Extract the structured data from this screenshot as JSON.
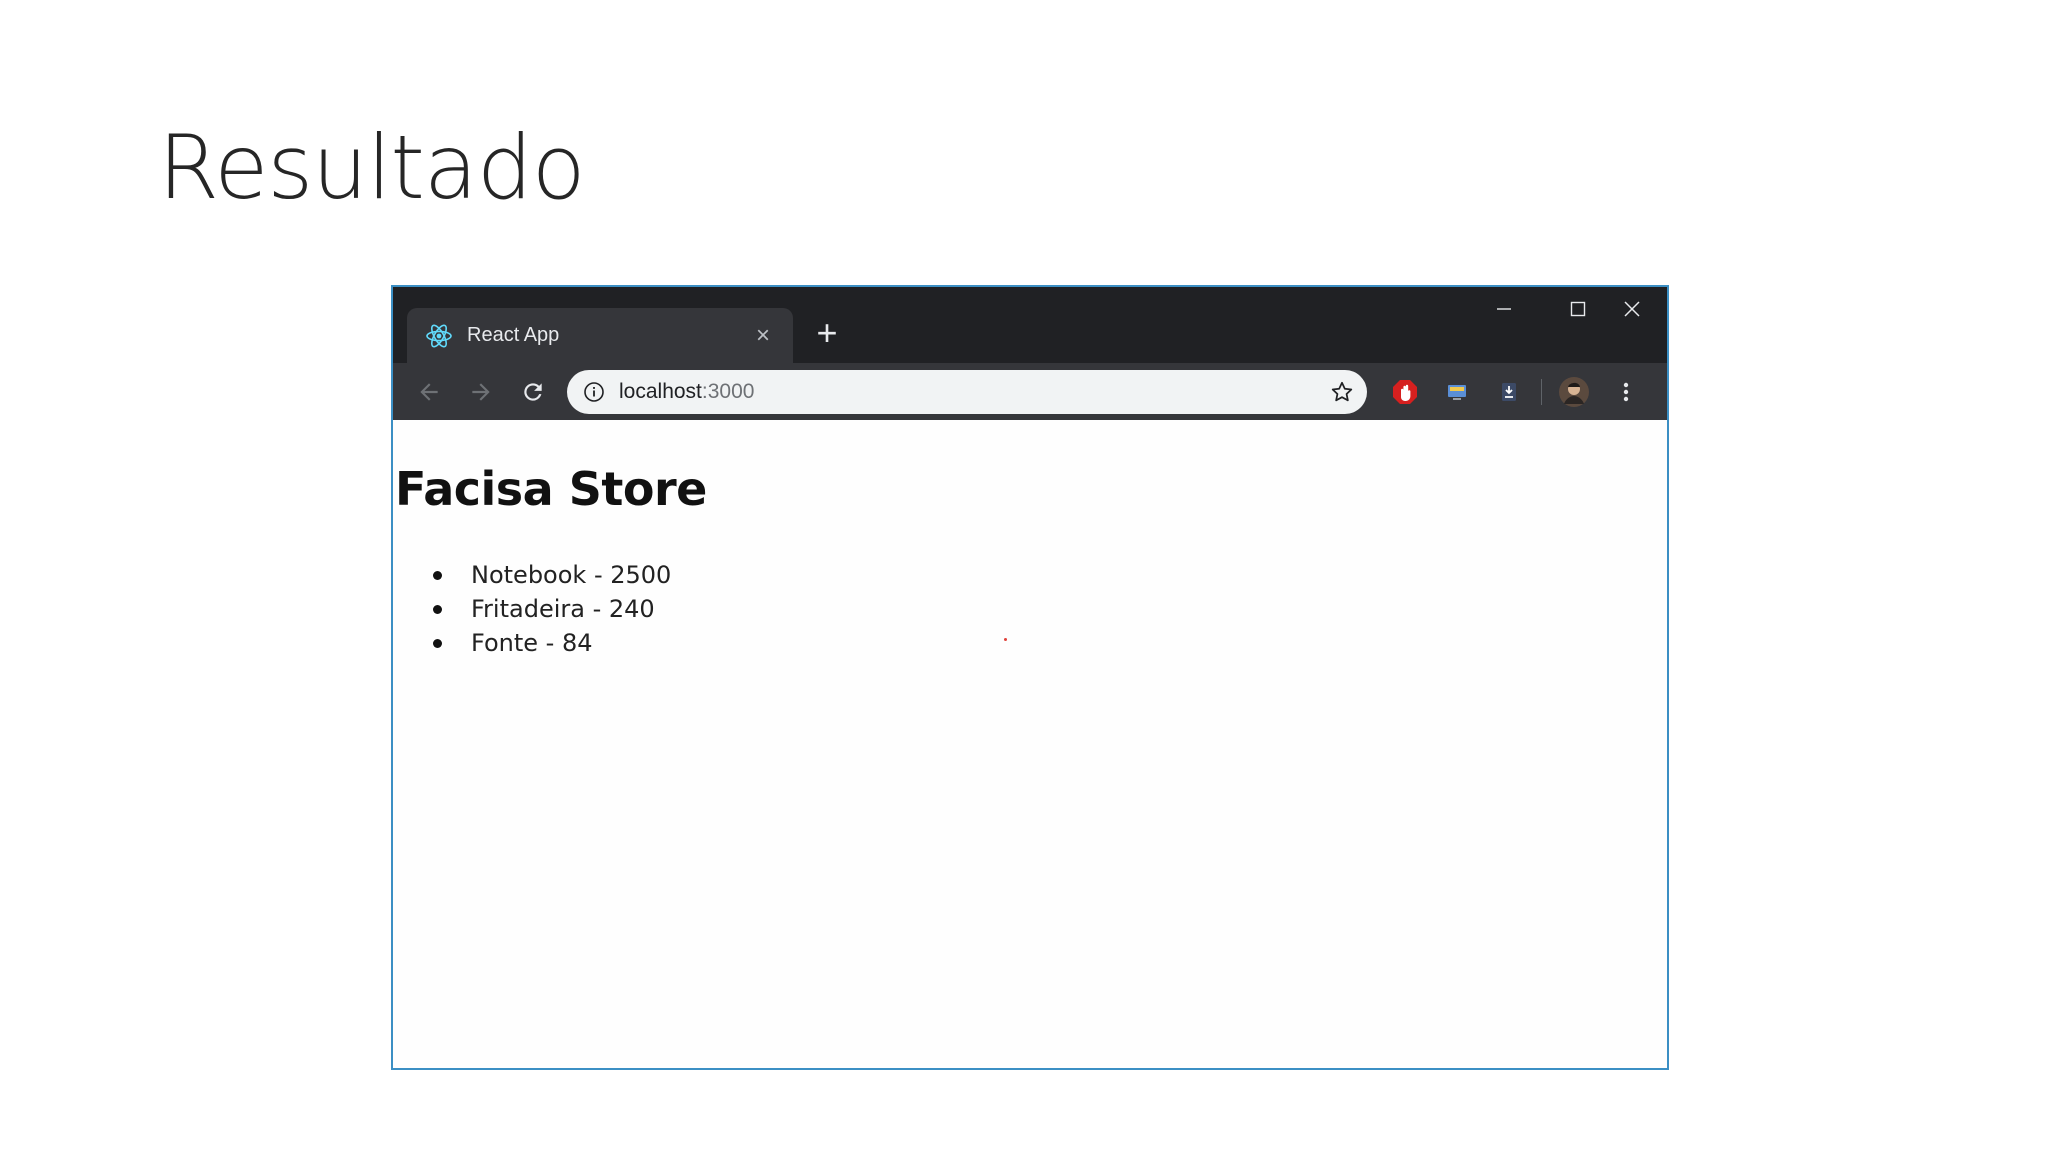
{
  "slide": {
    "title": "Resultado"
  },
  "browser": {
    "tab": {
      "favicon": "react-logo-icon",
      "title": "React App",
      "close_glyph": "×"
    },
    "new_tab_glyph": "+",
    "window_controls": [
      "minimize-icon",
      "maximize-icon",
      "close-icon"
    ],
    "toolbar": {
      "back": "back-arrow-icon",
      "forward": "forward-arrow-icon",
      "reload": "reload-icon",
      "url_host": "localhost",
      "url_port": ":3000",
      "site_info": "info-icon",
      "bookmark": "star-icon"
    },
    "extensions": [
      "adblock-icon",
      "screen-icon",
      "download-icon",
      "profile-avatar",
      "menu-kebab-icon"
    ]
  },
  "page": {
    "heading": "Facisa Store",
    "products": [
      {
        "text": "Notebook - 2500"
      },
      {
        "text": "Fritadeira - 240"
      },
      {
        "text": "Fonte - 84"
      }
    ]
  },
  "colors": {
    "tabstrip": "#202124",
    "toolbar": "#35363a",
    "omnibox": "#f1f3f4",
    "frame_border": "#3b8fc4",
    "react_blue": "#61dafb"
  }
}
